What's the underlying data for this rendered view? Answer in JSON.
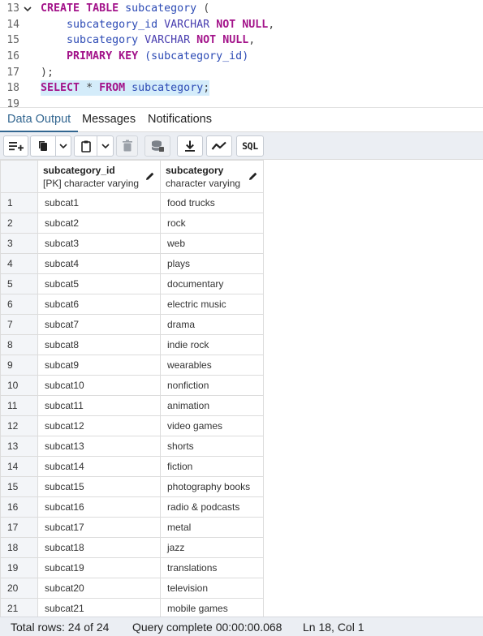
{
  "editor": {
    "lines": [
      {
        "num": "13",
        "fold": true
      },
      {
        "num": "14"
      },
      {
        "num": "15"
      },
      {
        "num": "16"
      },
      {
        "num": "17"
      },
      {
        "num": "18"
      },
      {
        "num": "19"
      }
    ],
    "tokens": {
      "create": "CREATE",
      "table": "TABLE",
      "tname": "subcategory",
      "lparen": "(",
      "col1": "subcategory_id",
      "varchar1": "VARCHAR",
      "notnull1": "NOT NULL",
      "comma1": ",",
      "col2": "subcategory",
      "varchar2": "VARCHAR",
      "notnull2": "NOT NULL",
      "comma2": ",",
      "pk": "PRIMARY KEY",
      "pkcol": "(subcategory_id)",
      "close": ");",
      "select": "SELECT",
      "star": "*",
      "from": "FROM",
      "selname": "subcategory",
      "semi": ";"
    }
  },
  "tabs": [
    {
      "label": "Data Output",
      "active": true
    },
    {
      "label": "Messages"
    },
    {
      "label": "Notifications"
    }
  ],
  "toolbar": {
    "sql_label": "SQL",
    "icons": [
      "add-row-icon",
      "copy-icon",
      "chevron-down-icon",
      "paste-icon",
      "chevron-down-icon",
      "delete-icon",
      "save-data-icon",
      "download-icon",
      "graph-icon",
      "sql-icon"
    ]
  },
  "grid": {
    "columns": [
      {
        "name": "subcategory_id",
        "type": "[PK] character varying"
      },
      {
        "name": "subcategory",
        "type": "character varying"
      }
    ],
    "rows": [
      [
        "1",
        "subcat1",
        "food trucks"
      ],
      [
        "2",
        "subcat2",
        "rock"
      ],
      [
        "3",
        "subcat3",
        "web"
      ],
      [
        "4",
        "subcat4",
        "plays"
      ],
      [
        "5",
        "subcat5",
        "documentary"
      ],
      [
        "6",
        "subcat6",
        "electric music"
      ],
      [
        "7",
        "subcat7",
        "drama"
      ],
      [
        "8",
        "subcat8",
        "indie rock"
      ],
      [
        "9",
        "subcat9",
        "wearables"
      ],
      [
        "10",
        "subcat10",
        "nonfiction"
      ],
      [
        "11",
        "subcat11",
        "animation"
      ],
      [
        "12",
        "subcat12",
        "video games"
      ],
      [
        "13",
        "subcat13",
        "shorts"
      ],
      [
        "14",
        "subcat14",
        "fiction"
      ],
      [
        "15",
        "subcat15",
        "photography books"
      ],
      [
        "16",
        "subcat16",
        "radio & podcasts"
      ],
      [
        "17",
        "subcat17",
        "metal"
      ],
      [
        "18",
        "subcat18",
        "jazz"
      ],
      [
        "19",
        "subcat19",
        "translations"
      ],
      [
        "20",
        "subcat20",
        "television"
      ],
      [
        "21",
        "subcat21",
        "mobile games"
      ]
    ]
  },
  "status": {
    "total_rows": "Total rows: 24 of 24",
    "query": "Query complete 00:00:00.068",
    "position": "Ln 18, Col 1"
  },
  "colors": {
    "accent": "#326690",
    "keyword": "#a3138a",
    "selection": "#d4ecfa"
  }
}
